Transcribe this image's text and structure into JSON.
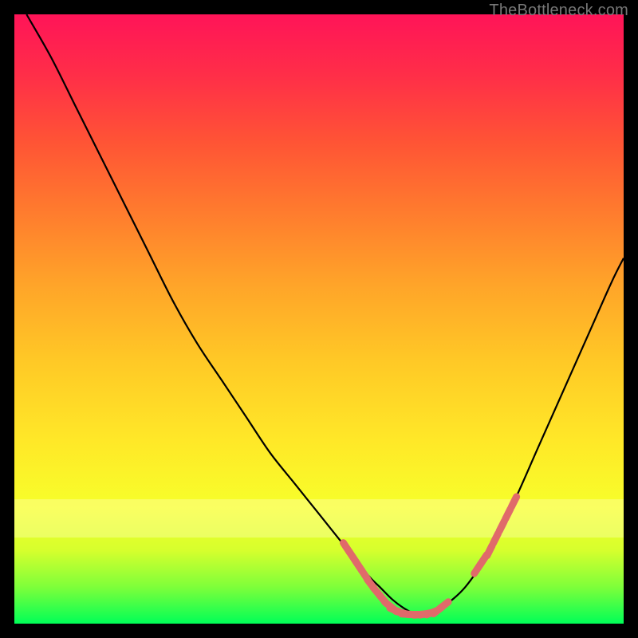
{
  "attribution": "TheBottleneck.com",
  "colors": {
    "background": "#000000",
    "curve": "#000000",
    "marker": "#e06a6a",
    "gradient_top": "#ff1458",
    "gradient_bottom": "#00ff57"
  },
  "chart_data": {
    "type": "line",
    "title": "",
    "xlabel": "",
    "ylabel": "",
    "xlim": [
      0,
      100
    ],
    "ylim": [
      0,
      100
    ],
    "grid": false,
    "series": [
      {
        "name": "bottleneck-curve",
        "x": [
          2,
          6,
          10,
          14,
          18,
          22,
          26,
          30,
          34,
          38,
          42,
          46,
          50,
          54,
          58,
          60,
          62,
          64,
          66,
          68,
          70,
          74,
          78,
          82,
          86,
          90,
          94,
          98,
          100
        ],
        "y": [
          100,
          93,
          85,
          77,
          69,
          61,
          53,
          46,
          40,
          34,
          28,
          23,
          18,
          13,
          8,
          6,
          4,
          2.5,
          1.5,
          1.5,
          2.5,
          6,
          12,
          20,
          29,
          38,
          47,
          56,
          60
        ]
      }
    ],
    "markers": [
      {
        "name": "left-descent-markers",
        "x": [
          54.5,
          55.5,
          56.5,
          57.5,
          58.5,
          59.5,
          60.5
        ],
        "y": [
          12.5,
          11,
          9.5,
          8,
          6.5,
          5.2,
          4
        ]
      },
      {
        "name": "bottom-floor-markers",
        "x": [
          61.5,
          62.5,
          63.5,
          64.5,
          65.5,
          66.5,
          67.5,
          68.5,
          69.5,
          70.5
        ],
        "y": [
          3,
          2.2,
          1.8,
          1.55,
          1.5,
          1.5,
          1.6,
          1.8,
          2.2,
          3
        ]
      },
      {
        "name": "right-ascent-markers",
        "x": [
          76,
          77,
          78,
          79,
          80,
          81,
          82
        ],
        "y": [
          9,
          10.5,
          12,
          14,
          16,
          18,
          20
        ]
      }
    ],
    "annotations": []
  }
}
